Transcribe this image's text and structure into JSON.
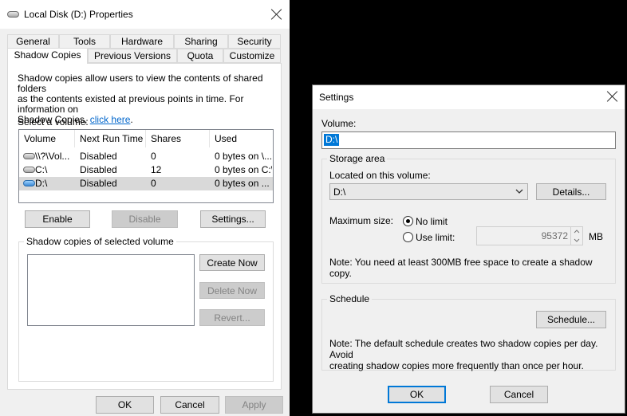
{
  "props": {
    "title": "Local Disk (D:) Properties",
    "tabs_row1": [
      "General",
      "Tools",
      "Hardware",
      "Sharing",
      "Security"
    ],
    "tabs_row2": [
      "Shadow Copies",
      "Previous Versions",
      "Quota",
      "Customize"
    ],
    "description_1": "Shadow copies allow users to view the contents of shared folders",
    "description_2": "as the contents existed at previous points in time. For information on",
    "description_3": "Shadow Copies, ",
    "link": "click here",
    "description_end": ".",
    "select_label": "Select a volume:",
    "columns": [
      "Volume",
      "Next Run Time",
      "Shares",
      "Used"
    ],
    "volumes": [
      {
        "volume": "\\\\?\\Vol...",
        "next_run": "Disabled",
        "shares": "0",
        "used": "0 bytes on \\..."
      },
      {
        "volume": "C:\\",
        "next_run": "Disabled",
        "shares": "12",
        "used": "0 bytes on C:\\"
      },
      {
        "volume": "D:\\",
        "next_run": "Disabled",
        "shares": "0",
        "used": "0 bytes on ..."
      }
    ],
    "enable": "Enable",
    "disable": "Disable",
    "settings": "Settings...",
    "group_label": "Shadow copies of selected volume",
    "create_now": "Create Now",
    "delete_now": "Delete Now",
    "revert": "Revert...",
    "ok": "OK",
    "cancel": "Cancel",
    "apply": "Apply"
  },
  "settings": {
    "title": "Settings",
    "volume_label": "Volume:",
    "volume_value": "D:\\",
    "storage_group": "Storage area",
    "located_label": "Located on this volume:",
    "located_value": "D:\\",
    "details": "Details...",
    "max_size_label": "Maximum size:",
    "no_limit": "No limit",
    "use_limit": "Use limit:",
    "limit_value": "95372",
    "unit": "MB",
    "note_storage": "Note: You need at least 300MB free space to create a shadow copy.",
    "schedule_group": "Schedule",
    "schedule_button": "Schedule...",
    "note_schedule_1": "Note: The default schedule creates two shadow copies per day. Avoid",
    "note_schedule_2": "creating shadow copies more frequently than once per hour.",
    "ok": "OK",
    "cancel": "Cancel"
  },
  "colors": {
    "accent": "#0078d7",
    "link": "#0066cc",
    "selected_row": "#d9d9d9"
  }
}
